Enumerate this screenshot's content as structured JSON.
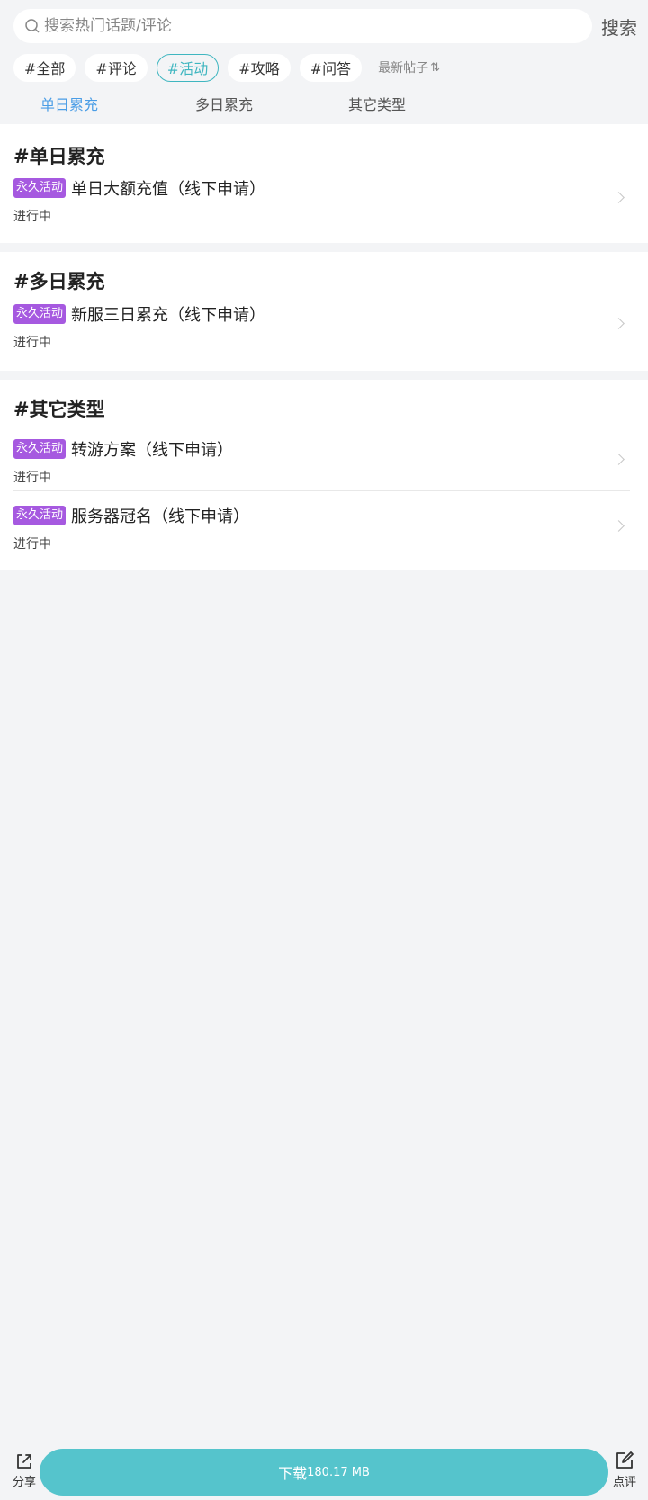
{
  "search": {
    "placeholder": "搜索热门话题/评论",
    "button_label": "搜索"
  },
  "filters": {
    "chips": [
      "#全部",
      "#评论",
      "#活动",
      "#攻略",
      "#问答"
    ],
    "active_chip": "#活动",
    "sort_label": "最新帖子",
    "accent_color": "#3fb6c0"
  },
  "tabs": {
    "items": [
      "单日累充",
      "多日累充",
      "其它类型"
    ],
    "active": "单日累充",
    "active_color": "#4a9de6"
  },
  "sections": [
    {
      "title": "#单日累充",
      "items": [
        {
          "badge": "永久活动",
          "title": "单日大额充值（线下申请）",
          "status": "进行中"
        }
      ]
    },
    {
      "title": "#多日累充",
      "items": [
        {
          "badge": "永久活动",
          "title": "新服三日累充（线下申请）",
          "status": "进行中"
        }
      ]
    },
    {
      "title": "#其它类型",
      "items": [
        {
          "badge": "永久活动",
          "title": "转游方案（线下申请）",
          "status": "进行中"
        },
        {
          "badge": "永久活动",
          "title": "服务器冠名（线下申请）",
          "status": "进行中"
        }
      ]
    }
  ],
  "badge_color": "#a659e0",
  "bottom_bar": {
    "share_label": "分享",
    "download_label": "下载",
    "download_size": "180.17 MB",
    "review_label": "点评",
    "download_color": "#55c4cc"
  }
}
